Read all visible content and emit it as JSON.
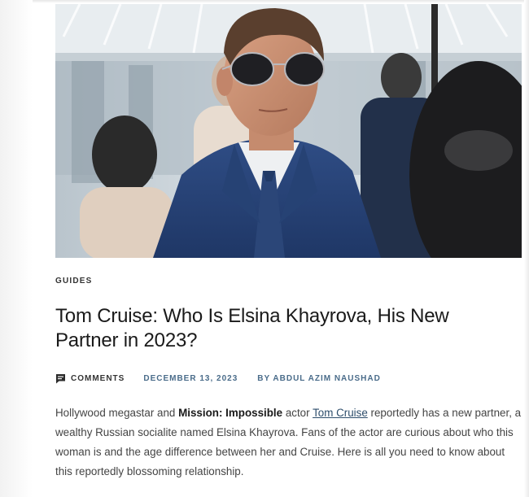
{
  "article": {
    "category": "GUIDES",
    "title": "Tom Cruise: Who Is Elsina Khayrova, His New Partner in 2023?",
    "meta": {
      "comments_label": "COMMENTS",
      "date": "DECEMBER 13, 2023",
      "author": "BY ABDUL AZIM NAUSHAD"
    },
    "body": {
      "part1": "Hollywood megastar and ",
      "bold": "Mission: Impossible",
      "part2": " actor ",
      "link": "Tom Cruise",
      "part3": " reportedly has a new partner, a wealthy Russian socialite named Elsina Khayrova. Fans of the actor are curious about who this woman is and the age difference between her and Cruise. Here is all you need to know about this reportedly blossoming relationship."
    }
  },
  "icons": {
    "comments": "comment-bubble-icon"
  },
  "colors": {
    "meta_link": "#4a6c8a",
    "link": "#2d4d6b",
    "text": "#444444",
    "heading": "#1a1a1a"
  }
}
